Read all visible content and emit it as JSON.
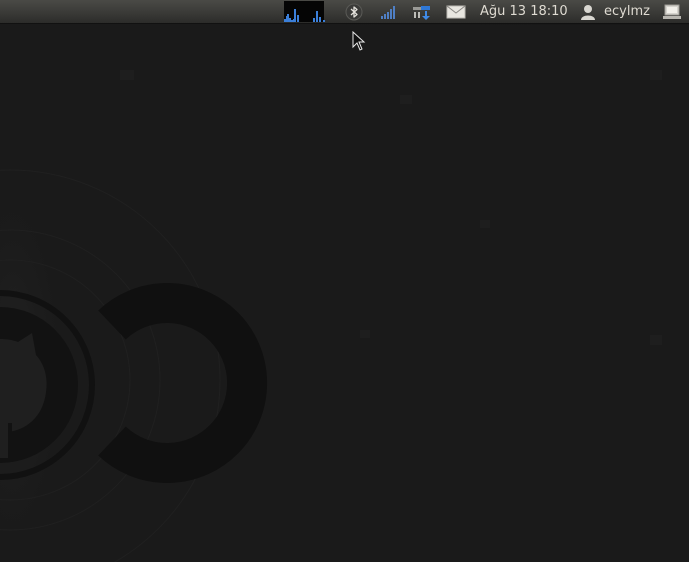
{
  "panel": {
    "system_monitor": {
      "icon": "system-monitor-graph",
      "bar_levels": [
        0.15,
        0.4,
        0.1,
        0.6,
        0.35,
        0.2,
        0.5,
        0.25,
        0.1,
        0.3,
        0.2,
        0.15
      ],
      "accent": "#3b7fd9"
    },
    "indicators": {
      "bluetooth": "bluetooth-icon",
      "network": "network-signal-icon",
      "transfer": "network-transfer-icon",
      "messages": "envelope-icon"
    },
    "clock": {
      "text": "Ağu 13 18:10"
    },
    "user": {
      "icon": "user-icon",
      "name": "ecylmz"
    },
    "session": {
      "icon": "session-icon"
    }
  },
  "desktop": {
    "wallpaper": "github-octocat-dark",
    "background": "#1a1a1a"
  }
}
